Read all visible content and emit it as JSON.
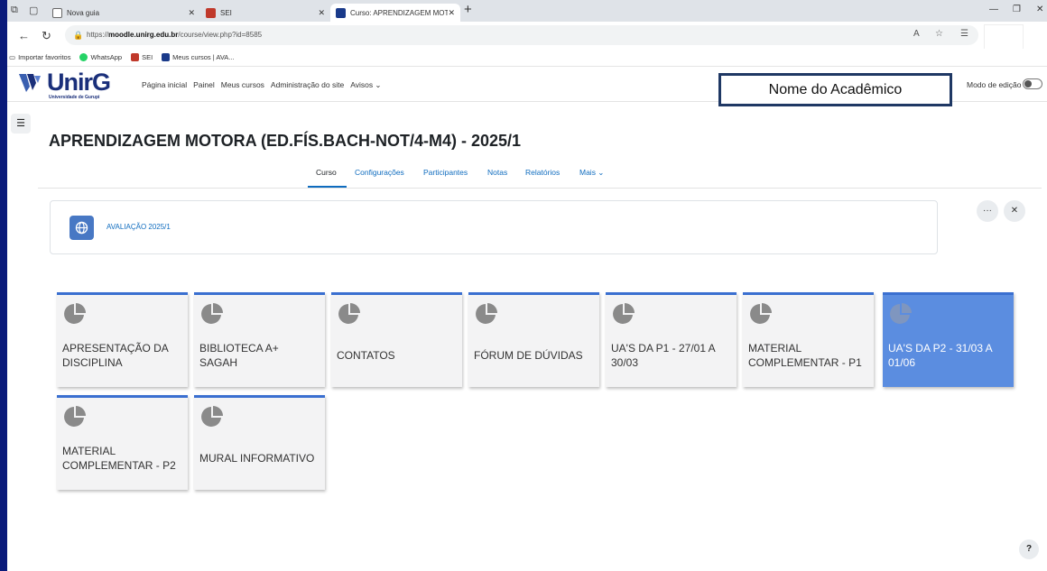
{
  "browser": {
    "tabs": [
      {
        "label": "Nova guia",
        "icon": "new-tab-icon"
      },
      {
        "label": "SEI",
        "icon": "sei-favicon-icon"
      },
      {
        "label": "Curso: APRENDIZAGEM MOTORA",
        "icon": "moodle-favicon-icon"
      }
    ],
    "url_prefix": "https://",
    "url_host": "moodle.unirg.edu.br",
    "url_path": "/course/view.php?id=8585",
    "favorites": [
      {
        "label": "Importar favoritos",
        "icon": "import-favorites-icon"
      },
      {
        "label": "WhatsApp",
        "icon": "whatsapp-icon"
      },
      {
        "label": "SEI",
        "icon": "sei-favicon-icon"
      },
      {
        "label": "Meus cursos | AVA...",
        "icon": "moodle-favicon-icon"
      }
    ]
  },
  "site": {
    "logo_text": "UnirG",
    "logo_subtext": "Universidade de Gurupi",
    "menu": [
      "Página inicial",
      "Painel",
      "Meus cursos",
      "Administração do site",
      "Avisos ⌄"
    ],
    "student_name_box": "Nome do Acadêmico",
    "edit_mode_label": "Modo de edição"
  },
  "course": {
    "title": "APRENDIZAGEM MOTORA (ED.FÍS.BACH-NOT/4-M4) - 2025/1",
    "tabs": [
      "Curso",
      "Configurações",
      "Participantes",
      "Notas",
      "Relatórios",
      "Mais ⌄"
    ],
    "active_tab": "Curso",
    "announcement": "AVALIAÇÃO 2025/1",
    "tiles": [
      {
        "label": "APRESENTAÇÃO DA DISCIPLINA",
        "highlighted": false
      },
      {
        "label": "BIBLIOTECA A+ SAGAH",
        "highlighted": false
      },
      {
        "label": "CONTATOS",
        "highlighted": false
      },
      {
        "label": "FÓRUM DE DÚVIDAS",
        "highlighted": false
      },
      {
        "label": "UA'S DA P1 - 27/01 A 30/03",
        "highlighted": false
      },
      {
        "label": "MATERIAL COMPLEMENTAR - P1",
        "highlighted": false
      },
      {
        "label": "UA'S DA P2 - 31/03 A 01/06",
        "highlighted": true
      },
      {
        "label": "MATERIAL COMPLEMENTAR - P2",
        "highlighted": false
      },
      {
        "label": "MURAL INFORMATIVO",
        "highlighted": false
      }
    ],
    "help_label": "?"
  },
  "colors": {
    "accent": "#0f6cbf",
    "tile_border": "#3a6fd0",
    "tile_highlight": "#5b8de0",
    "name_box_border": "#1f3864"
  }
}
